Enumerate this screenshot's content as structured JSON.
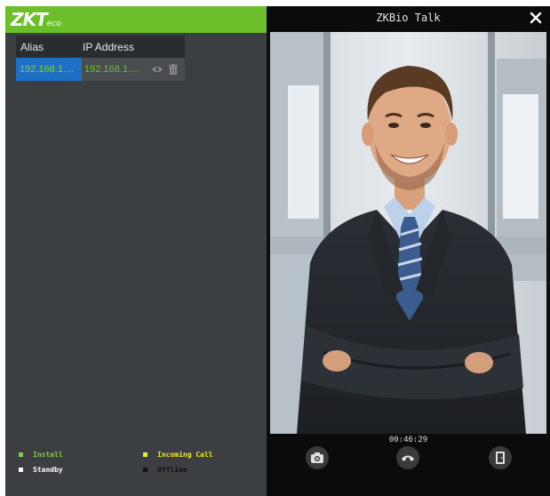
{
  "left": {
    "logo_main": "ZKT",
    "logo_small": "eco",
    "table": {
      "headers": [
        "Alias",
        "IP Address"
      ],
      "rows": [
        {
          "alias": "192.168.1....",
          "ip": "192.168.1...."
        }
      ]
    },
    "legend": [
      {
        "label": "Install",
        "color": "#7fd23b"
      },
      {
        "label": "Incoming Call",
        "color": "#f2ea1c"
      },
      {
        "label": "Standby",
        "color": "#ffffff"
      },
      {
        "label": "Offline",
        "color": "#111111"
      }
    ]
  },
  "right": {
    "title": "ZKBio Talk",
    "timer": "00:46:29"
  },
  "icons": [
    "eye-icon",
    "trash-icon",
    "close-icon",
    "camera-icon",
    "hangup-icon",
    "door-icon"
  ]
}
